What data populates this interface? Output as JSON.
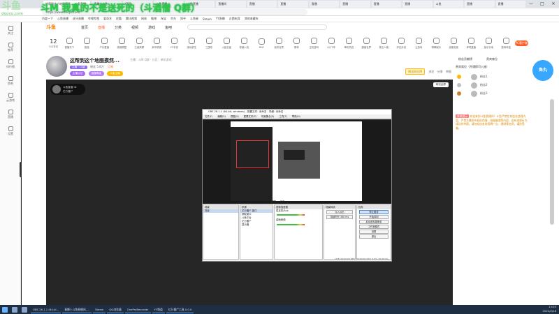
{
  "overlay_banner": "斗M 我真的不是送死的（斗酒僧 Q群）",
  "watermark_logo": {
    "main": "斗鱼",
    "sub": "douyu.com"
  },
  "browser": {
    "tabs": [
      "直播 | 斗鱼",
      "OBS",
      "斗鱼直播",
      "斗鱼直播",
      "直播间",
      "直播",
      "直播",
      "直播",
      "直播",
      "直播",
      "直播",
      "斗鱼",
      "直播",
      "直播"
    ],
    "active_tab_label": "这帮到这个地图摸然..._斗鱼直播",
    "url": "https://www.douyu.com/",
    "bookmarks": [
      "百度一下",
      "斗鱼直播",
      "虎牙直播",
      "哔哩哔哩",
      "爱奇艺",
      "优酷",
      "腾讯视频",
      "网易",
      "微博",
      "淘宝",
      "京东",
      "知乎",
      "斗鱼星",
      "Steam",
      "YY直播",
      "企鹅电竞",
      "其他收藏夹"
    ],
    "window_controls": [
      "—",
      "□",
      "✕"
    ]
  },
  "left_sidebar": [
    {
      "label": "关注",
      "icon": "heart-icon"
    },
    {
      "label": "推荐",
      "icon": "star-icon"
    },
    {
      "label": "排行榜",
      "icon": "rank-icon"
    },
    {
      "label": "鱼吧",
      "icon": "fish-icon"
    },
    {
      "label": "云游戏",
      "icon": "cloud-icon"
    },
    {
      "label": "直播",
      "icon": "live-icon"
    },
    {
      "label": "设置",
      "icon": "gear-icon"
    }
  ],
  "site_header": {
    "logo": "斗鱼",
    "nav": [
      "首页",
      "直播",
      "分类",
      "视频",
      "游戏",
      "鱼吧"
    ],
    "active_nav": 1
  },
  "date_widget": {
    "day": "12",
    "label": "今日签到"
  },
  "categories": [
    "直播天下",
    "颜值",
    "户外直播",
    "英雄联盟",
    "王者荣耀",
    "和平精英",
    "CF手游",
    "绝地求生",
    "三国杀",
    "火影忍者",
    "穿越火线",
    "DNF",
    "我的世界",
    "原神",
    "主机游戏",
    "QQ飞车",
    "单机热游",
    "魔兽世界",
    "第五人格",
    "炉石传说",
    "云游戏",
    "棋牌娱乐",
    "高能电竞",
    "体育直播",
    "鱼乐天地",
    "数码科技"
  ],
  "pc_button": "PC客户端",
  "room": {
    "title": "这帮到这个地图摸然...",
    "meta": "主播：斗M Q群  ·  分区：单机游戏",
    "line2": [
      "主播 · 11级",
      "粉丝 5.8万",
      "订阅"
    ],
    "badges": [
      "主播认证",
      "直播等级",
      "斗鱼主播"
    ],
    "give_gift": "赠送粉丝牌",
    "actions": [
      "关注",
      "分享",
      "举报"
    ]
  },
  "player": {
    "room_watermark_top": "斗鱼直播 ID",
    "room_watermark_bottom": "亿万僵尸",
    "fullscreen": "网页全屏"
  },
  "obs": {
    "title": "OBS 26.1.1 (64-bit, windows) - 配置文件: 未命名 - 场景: 未命名",
    "menu": [
      "文件(F)",
      "编辑(E)",
      "视图(V)",
      "配置文件(P)",
      "场景集合(S)",
      "工具(T)",
      "帮助(H)"
    ],
    "mini_buttons": [
      "属性",
      "滤镜",
      "亿万"
    ],
    "panels": {
      "scenes": {
        "header": "场景",
        "items": [
          "场景"
        ]
      },
      "sources": {
        "header": "来源",
        "items": [
          "亿万僵尸-窗口",
          "获取窗口",
          "斗鱼平台",
          "亿万僵尸",
          "显示器"
        ]
      },
      "mixer": {
        "header": "音频混音器",
        "items": [
          "麦克风/Aux",
          "桌面音频"
        ]
      },
      "transitions": {
        "header": "场景转场",
        "items": [
          "淡入淡出",
          "持续时长 300 ms"
        ]
      },
      "controls": {
        "header": "控件",
        "items": [
          "停止推流",
          "开始录制",
          "启动虚拟摄像机",
          "工作室模式",
          "设置",
          "退出"
        ]
      }
    },
    "status": "LIVE: 00:00:00   REC: 00:00:00   CPU: 3.5%, 60.00 fps"
  },
  "right_panel": {
    "tabs": [
      "粉丝贡献榜",
      "贵宾席位"
    ],
    "vip_note": "贵宾席位（开通即可入座）",
    "rank": [
      {
        "name": "粉丝1",
        "medal_color": "#ffb800"
      },
      {
        "name": "粉丝2",
        "medal_color": "#c0c0c0"
      },
      {
        "name": "粉丝3",
        "medal_color": "#cd7f32"
      }
    ],
    "notice_label": "系统提示",
    "notice_text": "欢迎来到斗鱼直播间！斗鱼严禁任何违法违规内容，严禁主播发布低俗色情、吸烟酗酒等内容，若有违规行为请及时举报。请勿轻信各类招聘广告、理财等信息，谨防受骗。"
  },
  "float_button": "鱼丸",
  "taskbar": {
    "apps": [
      "OBS 26.1.1 (64-bi...",
      "直播人斗鱼直播间_...",
      "Steam",
      "QQ浏览器",
      "OneProRecorder",
      "YY频道",
      "亿万僵尸工具 0.0.0"
    ],
    "time": "13:03",
    "date": "2022/2/18"
  }
}
